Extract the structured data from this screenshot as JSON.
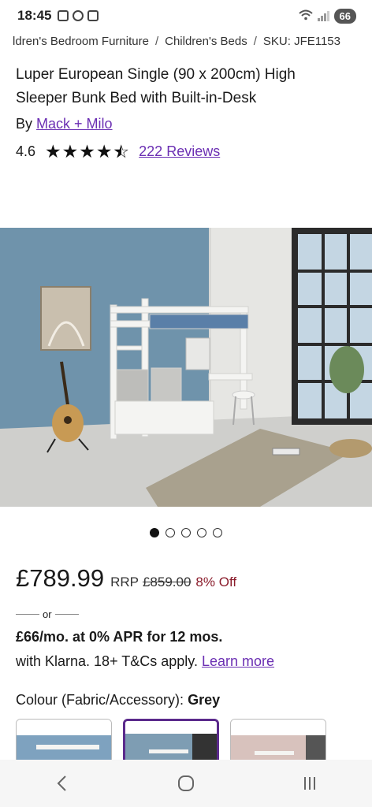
{
  "status_bar": {
    "time": "18:45",
    "battery": "66"
  },
  "breadcrumb": {
    "crumb1": "ldren's Bedroom Furniture",
    "crumb2": "Children's Beds",
    "sku": "SKU: JFE1153",
    "separator": "/"
  },
  "product": {
    "title": "Luper European Single (90 x 200cm) High Sleeper Bunk Bed with Built-in-Desk",
    "by_label": "By",
    "brand": "Mack + Milo",
    "rating": "4.6",
    "rating_value": 4.6,
    "rating_max": 5,
    "reviews": "222 Reviews"
  },
  "gallery": {
    "image_count": 5,
    "active_index": 0
  },
  "pricing": {
    "price": "£789.99",
    "rrp_label": "RRP",
    "rrp": "£859.00",
    "discount": "8% Off"
  },
  "finance": {
    "or_text": "or",
    "headline": "£66/mo. at 0% APR for 12 mos.",
    "terms": "with Klarna. 18+ T&Cs apply.",
    "learn_more": "Learn more"
  },
  "options": {
    "colour_label": "Colour (Fabric/Accessory):",
    "colour_value": "Grey",
    "selected_swatch_index": 1
  },
  "colors": {
    "link": "#6b2fb3",
    "discount": "#8a1c2b",
    "selected_border": "#5b2a8c"
  },
  "nav": {
    "icons": [
      "back-icon",
      "home-icon",
      "recents-icon"
    ]
  }
}
